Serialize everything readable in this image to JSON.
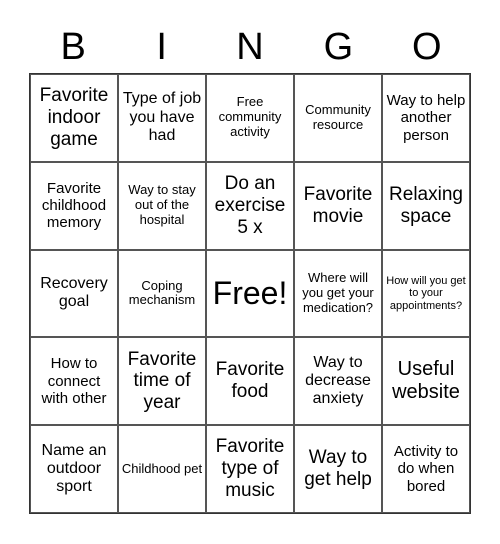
{
  "header": {
    "letters": [
      "B",
      "I",
      "N",
      "G",
      "O"
    ]
  },
  "cells": [
    "Favorite indoor game",
    "Type of job you have had",
    "Free community activity",
    "Community resource",
    "Way to help another person",
    "Favorite childhood memory",
    "Way to stay out of the hospital",
    "Do an exercise 5 x",
    "Favorite movie",
    "Relaxing space",
    "Recovery goal",
    "Coping mechanism",
    "Free!",
    "Where will you get your medication?",
    "How will you get to your appointments?",
    "How to connect with other",
    "Favorite time of year",
    "Favorite food",
    "Way to decrease anxiety",
    "Useful website",
    "Name an outdoor sport",
    "Childhood pet",
    "Favorite type of music",
    "Way to get help",
    "Activity to do when bored"
  ]
}
